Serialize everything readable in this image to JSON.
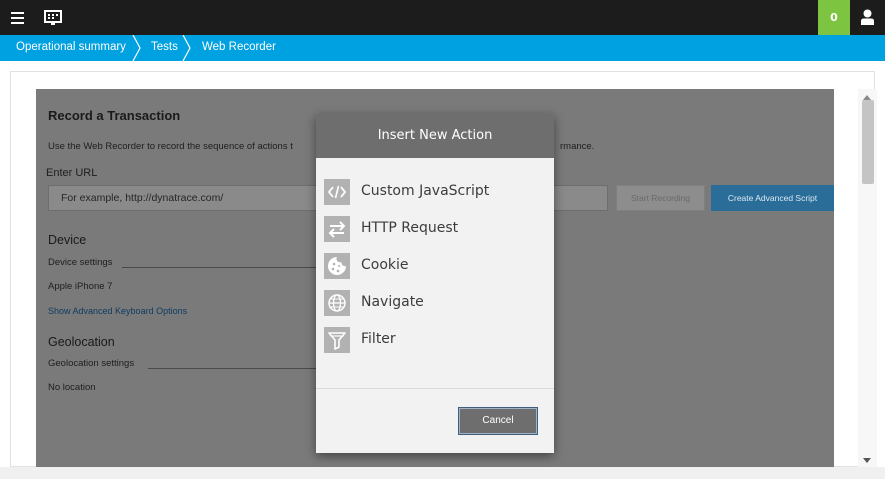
{
  "topbar": {
    "menu_icon": "hamburger-menu-icon",
    "monitor_icon": "monitor-icon",
    "notification_count": "0",
    "user_icon": "user-icon"
  },
  "breadcrumb": [
    "Operational summary",
    "Tests",
    "Web Recorder"
  ],
  "background": {
    "title": "Record a Transaction",
    "description": "Use the Web Recorder to record the sequence of actions t",
    "description_tail": "rmance.",
    "url_label": "Enter URL",
    "url_placeholder": "For example, http://dynatrace.com/",
    "start_recording": "Start Recording",
    "create_script": "Create Advanced Script",
    "device_heading": "Device",
    "device_settings": "Device settings",
    "device_value": "Apple iPhone 7",
    "keyboard_link": "Show Advanced Keyboard Options",
    "geo_heading": "Geolocation",
    "geo_settings": "Geolocation settings",
    "geo_value": "No location"
  },
  "modal": {
    "title": "Insert New Action",
    "actions": [
      {
        "label": "Custom JavaScript",
        "icon": "code-icon"
      },
      {
        "label": "HTTP Request",
        "icon": "swap-arrows-icon"
      },
      {
        "label": "Cookie",
        "icon": "cookie-icon"
      },
      {
        "label": "Navigate",
        "icon": "globe-icon"
      },
      {
        "label": "Filter",
        "icon": "filter-icon"
      }
    ],
    "cancel": "Cancel"
  },
  "colors": {
    "topbar": "#1c1c1c",
    "breadcrumb": "#00a1e0",
    "notification": "#7dc540",
    "modal_header": "#6e6e6e",
    "accent_button": "#2a6d99"
  }
}
